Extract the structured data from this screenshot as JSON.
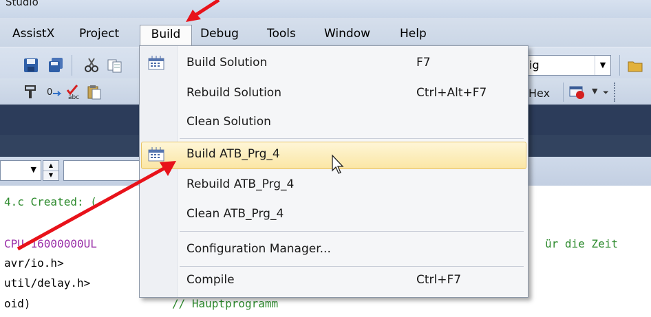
{
  "window": {
    "title_fragment": "Studio"
  },
  "menubar": {
    "items": [
      {
        "label": "AssistX"
      },
      {
        "label": "Project"
      },
      {
        "label": "Build"
      },
      {
        "label": "Debug"
      },
      {
        "label": "Tools"
      },
      {
        "label": "Window"
      },
      {
        "label": "Help"
      }
    ]
  },
  "toolbar": {
    "config_combo_value": "ig",
    "hex_label": "Hex"
  },
  "build_menu": {
    "items": [
      {
        "label": "Build Solution",
        "shortcut": "F7",
        "icon": "build-solution-icon"
      },
      {
        "label": "Rebuild Solution",
        "shortcut": "Ctrl+Alt+F7"
      },
      {
        "label": "Clean Solution",
        "shortcut": ""
      },
      {
        "label": "Build ATB_Prg_4",
        "shortcut": "",
        "icon": "build-project-icon",
        "highlighted": true
      },
      {
        "label": "Rebuild ATB_Prg_4",
        "shortcut": ""
      },
      {
        "label": "Clean ATB_Prg_4",
        "shortcut": ""
      },
      {
        "label": "Configuration Manager...",
        "shortcut": ""
      },
      {
        "label": "Compile",
        "shortcut": "Ctrl+F7"
      }
    ]
  },
  "editor": {
    "lines": [
      {
        "text": "4.c Created: (",
        "color": "green"
      },
      {
        "text": "CPU 16000000UL",
        "color": "purple"
      },
      {
        "text": "ür die Zeit",
        "color": "green"
      },
      {
        "text": "avr/io.h>",
        "color": "black"
      },
      {
        "text": "util/delay.h>",
        "color": "black"
      },
      {
        "text": "oid)",
        "color": "black"
      },
      {
        "text": "// Hauptprogramm",
        "color": "green"
      }
    ]
  },
  "colors": {
    "menu_highlight": "#fbe6a5",
    "arrow": "#e8121a",
    "dark_band": "#2c3c5a"
  }
}
